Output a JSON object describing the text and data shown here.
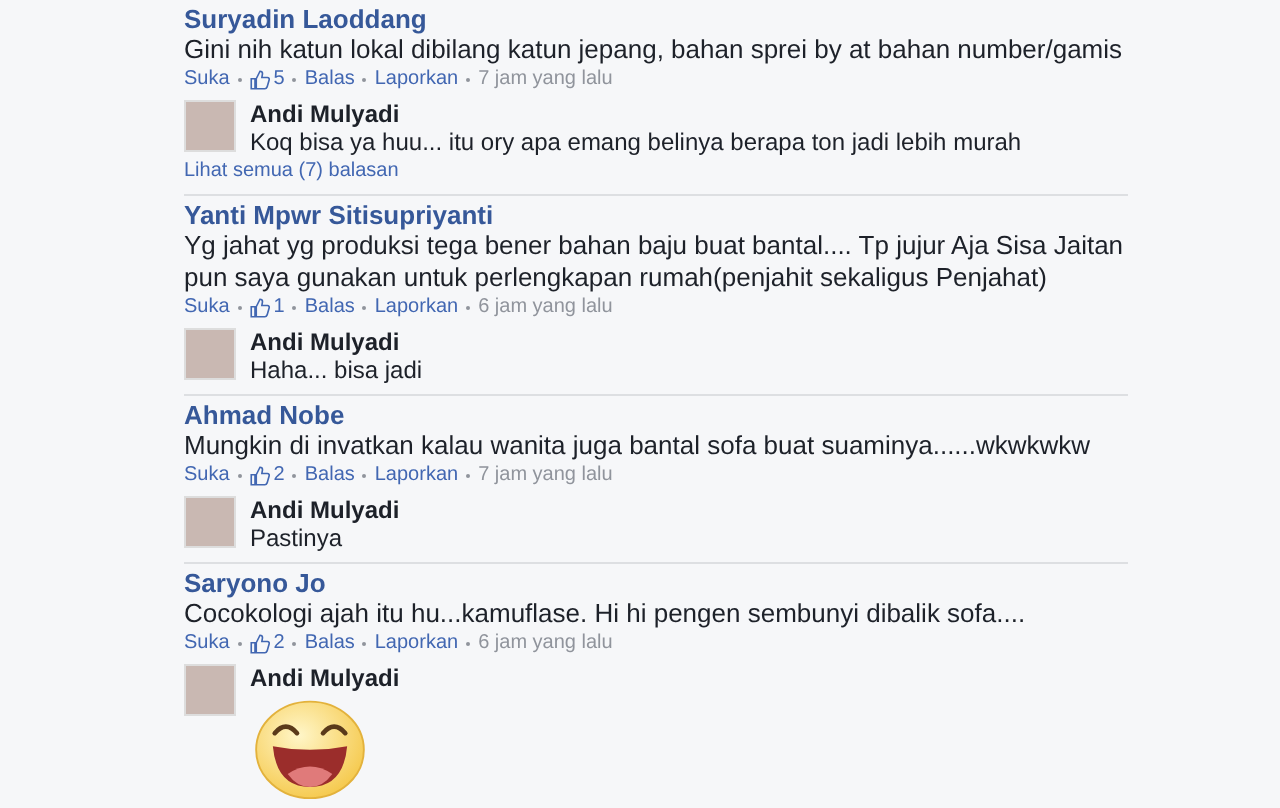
{
  "comments": [
    {
      "author": "Suryadin Laoddang",
      "text": "Gini nih katun lokal dibilang katun jepang, bahan sprei by at bahan number/gamis",
      "actions": [
        "Suka",
        "Balas",
        "Laporkan"
      ],
      "likes": "5",
      "time": "7 jam yang lalu",
      "replies": [
        {
          "author": "Andi Mulyadi",
          "kind": "text",
          "text": "Koq bisa ya huu... itu ory apa emang belinya berapa ton jadi lebih murah"
        }
      ],
      "view_more": "Lihat semua (7) balasan"
    },
    {
      "author": "Yanti Mpwr Sitisupriyanti",
      "text": "Yg jahat yg produksi tega bener bahan baju buat bantal.... Tp jujur Aja Sisa Jaitan pun saya gunakan untuk perlengkapan rumah(penjahit sekaligus Penjahat)",
      "actions": [
        "Suka",
        "Balas",
        "Laporkan"
      ],
      "likes": "1",
      "time": "6 jam yang lalu",
      "replies": [
        {
          "author": "Andi Mulyadi",
          "kind": "text",
          "text": "Haha... bisa jadi"
        }
      ]
    },
    {
      "author": "Ahmad Nobe",
      "text": "Mungkin di invatkan kalau wanita juga bantal sofa buat suaminya......wkwkwkw",
      "actions": [
        "Suka",
        "Balas",
        "Laporkan"
      ],
      "likes": "2",
      "time": "7 jam yang lalu",
      "replies": [
        {
          "author": "Andi Mulyadi",
          "kind": "text",
          "text": "Pastinya"
        }
      ]
    },
    {
      "author": "Saryono Jo",
      "text": "Cocokologi ajah itu hu...kamuflase. Hi hi pengen sembunyi dibalik sofa....",
      "actions": [
        "Suka",
        "Balas",
        "Laporkan"
      ],
      "likes": "2",
      "time": "6 jam yang lalu",
      "replies": [
        {
          "author": "Andi Mulyadi",
          "kind": "sticker"
        }
      ]
    }
  ]
}
